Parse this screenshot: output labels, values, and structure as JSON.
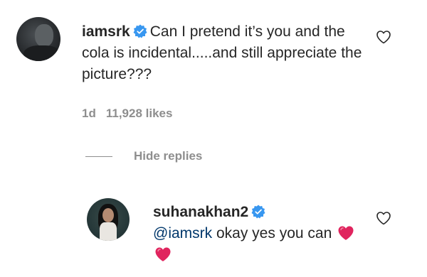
{
  "comment": {
    "username": "iamsrk",
    "text": "Can I pretend it’s you and the cola is incidental.....and still appreciate the picture???",
    "age": "1d",
    "likes": "11,928 likes"
  },
  "replies_toggle": {
    "label": "Hide replies"
  },
  "reply": {
    "username": "suhanakhan2",
    "mention": "@iamsrk",
    "text": " okay yes you can"
  },
  "colors": {
    "verified": "#3897f0",
    "heart": "#e0245e",
    "muted": "#8e8e8e",
    "mention": "#00376b"
  },
  "icons": {
    "verified": "verified-badge-icon",
    "like": "heart-outline-icon",
    "emoji": "red-heart-emoji"
  }
}
